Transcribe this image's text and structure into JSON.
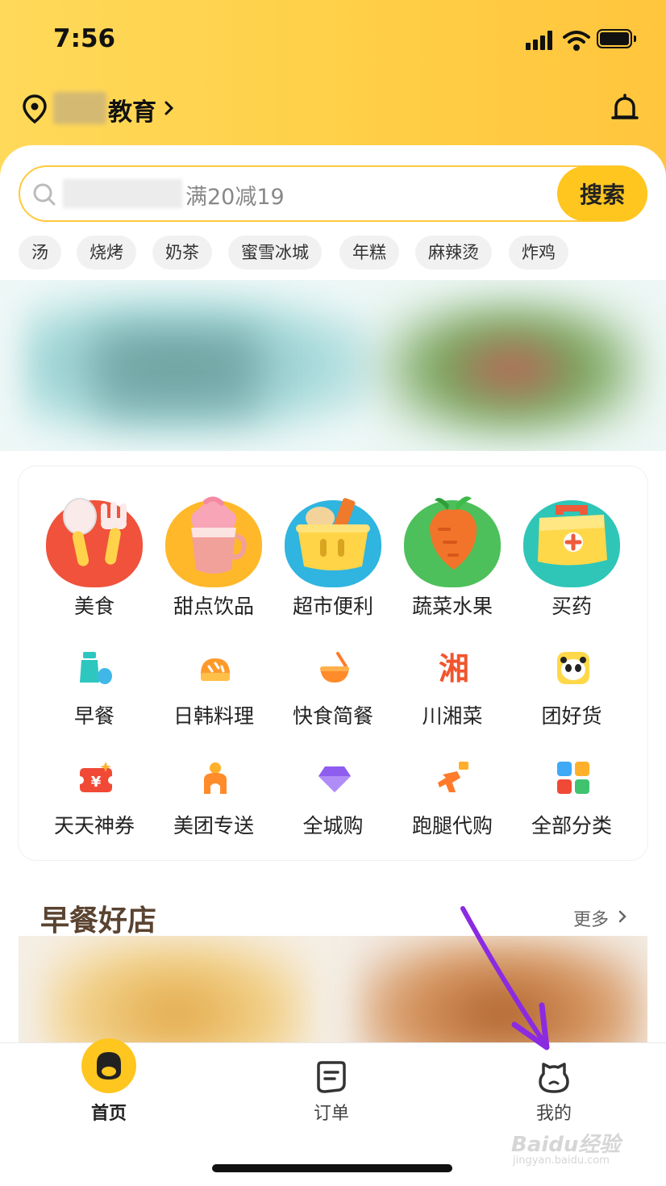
{
  "status_bar": {
    "time": "7:56"
  },
  "location": {
    "text": "教育"
  },
  "search": {
    "hint": "满20减19",
    "button_label": "搜索"
  },
  "hot_tags": [
    "汤",
    "烧烤",
    "奶茶",
    "蜜雪冰城",
    "年糕",
    "麻辣烫",
    "炸鸡"
  ],
  "categories_primary": [
    {
      "label": "美食",
      "icon": "fork-spoon-icon",
      "color": "#f0523c"
    },
    {
      "label": "甜点饮品",
      "icon": "ice-cream-icon",
      "color": "#ffb82a"
    },
    {
      "label": "超市便利",
      "icon": "shopping-basket-icon",
      "color": "#2fb5e0"
    },
    {
      "label": "蔬菜水果",
      "icon": "carrot-icon",
      "color": "#4dc05b"
    },
    {
      "label": "买药",
      "icon": "medicine-box-icon",
      "color": "#2fc6b8"
    }
  ],
  "categories_secondary": [
    {
      "label": "早餐",
      "icon": "milk-bottle-icon"
    },
    {
      "label": "日韩料理",
      "icon": "bread-icon"
    },
    {
      "label": "快食简餐",
      "icon": "bowl-icon"
    },
    {
      "label": "川湘菜",
      "icon": "xiang-character-icon",
      "glyph": "湘"
    },
    {
      "label": "团好货",
      "icon": "panda-icon"
    },
    {
      "label": "天天神券",
      "icon": "coupon-icon",
      "glyph": "¥"
    },
    {
      "label": "美团专送",
      "icon": "scooter-icon"
    },
    {
      "label": "全城购",
      "icon": "diamond-icon"
    },
    {
      "label": "跑腿代购",
      "icon": "runner-icon"
    },
    {
      "label": "全部分类",
      "icon": "grid-icon"
    }
  ],
  "breakfast_section": {
    "title": "早餐好店",
    "more_label": "更多"
  },
  "tabbar": {
    "home": "首页",
    "orders": "订单",
    "mine": "我的"
  },
  "watermark": {
    "main": "Baidu经验",
    "sub": "jingyan.baidu.com"
  },
  "colors": {
    "brand_yellow": "#ffc61f",
    "annotation_purple": "#8a2be2"
  }
}
